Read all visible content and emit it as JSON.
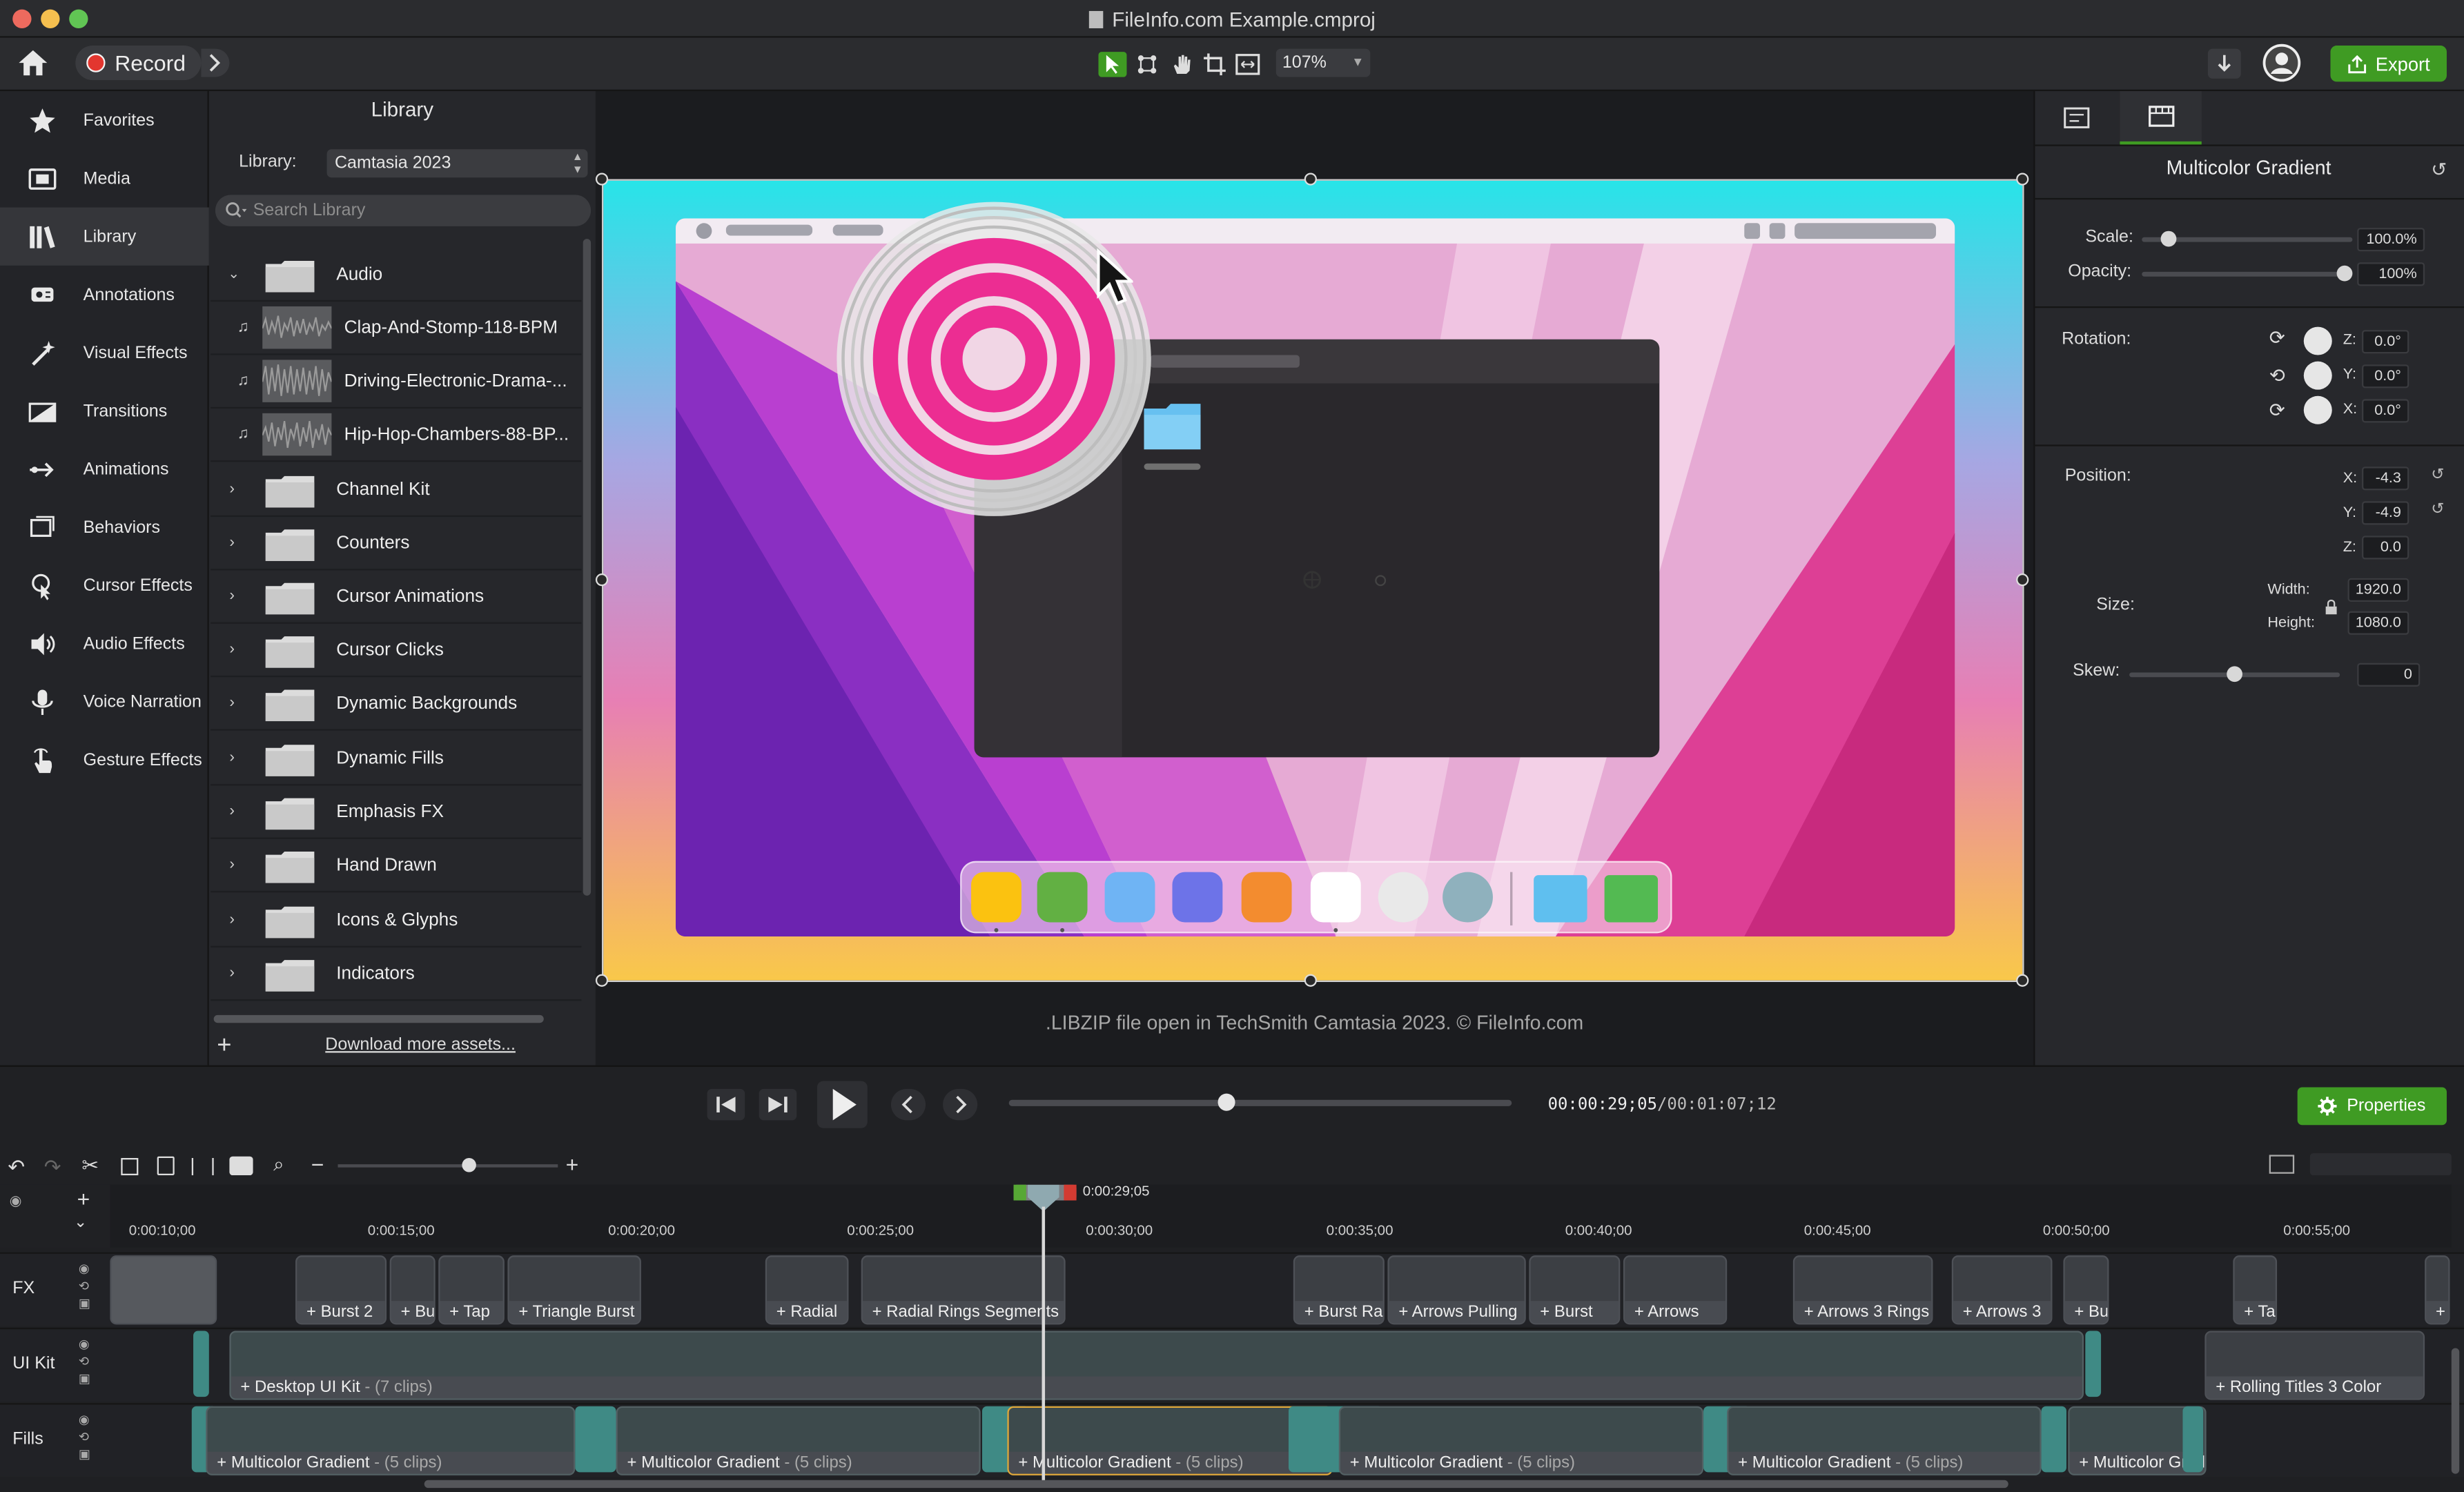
{
  "window": {
    "title": "FileInfo.com Example.cmproj"
  },
  "toolbar": {
    "record_label": "Record",
    "zoom": "107%",
    "export_label": "Export"
  },
  "sidebar": {
    "items": [
      {
        "label": "Favorites",
        "icon": "star-icon"
      },
      {
        "label": "Media",
        "icon": "film-icon"
      },
      {
        "label": "Library",
        "icon": "books-icon"
      },
      {
        "label": "Annotations",
        "icon": "annotation-icon"
      },
      {
        "label": "Visual Effects",
        "icon": "wand-icon"
      },
      {
        "label": "Transitions",
        "icon": "transition-icon"
      },
      {
        "label": "Animations",
        "icon": "arrow-animation-icon"
      },
      {
        "label": "Behaviors",
        "icon": "behaviors-icon"
      },
      {
        "label": "Cursor Effects",
        "icon": "cursor-effect-icon"
      },
      {
        "label": "Audio Effects",
        "icon": "speaker-icon"
      },
      {
        "label": "Voice Narration",
        "icon": "microphone-icon"
      },
      {
        "label": "Gesture Effects",
        "icon": "hand-gesture-icon"
      }
    ]
  },
  "library": {
    "title": "Library",
    "library_label": "Library:",
    "selected_library": "Camtasia 2023",
    "search_placeholder": "Search Library",
    "folders": [
      "Audio",
      "Channel Kit",
      "Counters",
      "Cursor Animations",
      "Cursor Clicks",
      "Dynamic Backgrounds",
      "Dynamic Fills",
      "Emphasis FX",
      "Hand Drawn",
      "Icons & Glyphs",
      "Indicators"
    ],
    "audio_items": [
      "Clap-And-Stomp-118-BPM",
      "Driving-Electronic-Drama-...",
      "Hip-Hop-Chambers-88-BP..."
    ],
    "download_link": "Download more assets..."
  },
  "canvas": {
    "caption": ".LIBZIP file open in TechSmith Camtasia 2023. © FileInfo.com"
  },
  "properties": {
    "title": "Multicolor Gradient",
    "scale_label": "Scale:",
    "scale_value": "100.0%",
    "scale_fraction": 0.1,
    "opacity_label": "Opacity:",
    "opacity_value": "100%",
    "opacity_fraction": 1.0,
    "rotation_label": "Rotation:",
    "rotation_z_label": "Z:",
    "rotation_z": "0.0°",
    "rotation_y_label": "Y:",
    "rotation_y": "0.0°",
    "rotation_x_label": "X:",
    "rotation_x": "0.0°",
    "position_label": "Position:",
    "position_x_label": "X:",
    "position_x": "-4.3",
    "position_y_label": "Y:",
    "position_y": "-4.9",
    "position_z_label": "Z:",
    "position_z": "0.0",
    "size_label": "Size:",
    "width_label": "Width:",
    "width": "1920.0",
    "height_label": "Height:",
    "height": "1080.0",
    "skew_label": "Skew:",
    "skew": "0",
    "skew_fraction": 0.5
  },
  "playback": {
    "time_current": "00:00:29;05",
    "time_total": "00:01:07;12",
    "progress": 0.43,
    "properties_label": "Properties"
  },
  "timeline": {
    "playhead_time": "0:00:29;05",
    "ruler": [
      "0:00:10;00",
      "0:00:15;00",
      "0:00:20;00",
      "0:00:25;00",
      "0:00:30;00",
      "0:00:35;00",
      "0:00:40;00",
      "0:00:45;00",
      "0:00:50;00",
      "0:00:55;00"
    ],
    "tracks": [
      {
        "name": "FX",
        "clips": [
          "Burst 2",
          "Bu",
          "Tap",
          "Triangle Burst",
          "Radial",
          "Radial Rings Segments",
          "Burst Ra",
          "Arrows Pulling",
          "Burst",
          "Arrows",
          "Arrows 3 Rings",
          "Arrows 3",
          "Bu",
          "Ta"
        ]
      },
      {
        "name": "UI Kit",
        "clips": [
          "Desktop UI Kit",
          "Rolling Titles 3 Color"
        ],
        "clip_sub": "- (7 clips)"
      },
      {
        "name": "Fills",
        "clips": [
          "Multicolor Gradient",
          "Multicolor Gradient",
          "Multicolor Gradient",
          "Multicolor Gradient",
          "Multicolor Gradient",
          "Multicolor Gradie"
        ],
        "clip_sub": "- (5 clips)"
      }
    ]
  }
}
